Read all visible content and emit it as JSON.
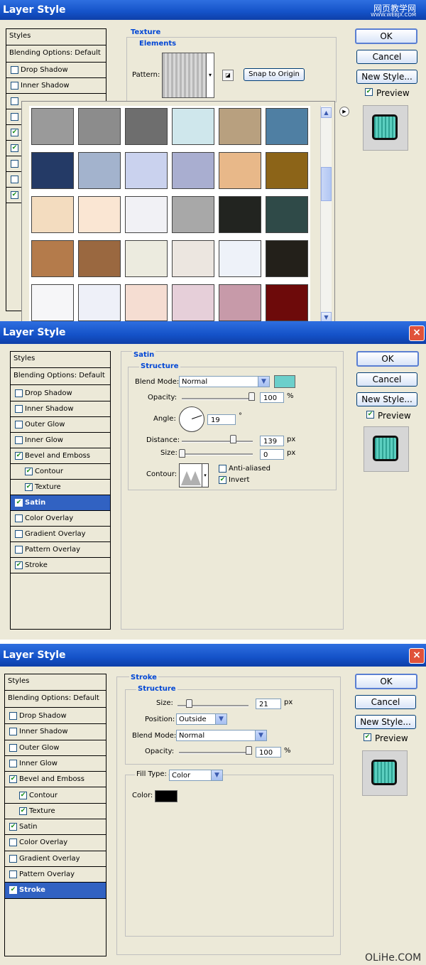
{
  "watermark_top": "网页教学网",
  "watermark_top_url": "WWW.WEBJX.COM",
  "watermark_bottom": "OLiHe.COM",
  "colors": {
    "accent": "#0046d5",
    "selected_row": "#3162c2",
    "satin_color": "#6ccfcb",
    "stroke_color": "#000000",
    "preview": "#3fb3a4"
  },
  "dialog1": {
    "title": "Layer Style",
    "styles_header": "Styles",
    "blending": "Blending Options: Default",
    "items": [
      {
        "label": "Drop Shadow",
        "checked": false
      },
      {
        "label": "Inner Shadow",
        "checked": false
      },
      {
        "label": "",
        "checked": false
      },
      {
        "label": "",
        "checked": false
      },
      {
        "label": "",
        "checked": true
      },
      {
        "label": "",
        "checked": true
      },
      {
        "label": "",
        "checked": false
      },
      {
        "label": "",
        "checked": false
      },
      {
        "label": "",
        "checked": true
      }
    ],
    "section": "Texture",
    "subsection": "Elements",
    "pattern_label": "Pattern:",
    "snap_button": "Snap to Origin",
    "buttons": {
      "ok": "OK",
      "cancel": "Cancel",
      "new_style": "New Style...",
      "preview": "Preview"
    },
    "swatches": [
      "#9a9a9a",
      "#8c8c8c",
      "#6e6e6e",
      "#cfe7ec",
      "#b8a07f",
      "#4f7fa3",
      "#243a66",
      "#a3b3cd",
      "#cad2ee",
      "#a9aed0",
      "#e8b889",
      "#8c6418",
      "#f3dcbf",
      "#fae6d3",
      "#f1f1f5",
      "#a8a8a8",
      "#222420",
      "#2f4a48",
      "#b47b4b",
      "#9a6840",
      "#ecebdf",
      "#ece6e0",
      "#eef2f9",
      "#23201a",
      "#f6f6f8",
      "#eef0f8",
      "#f5ddd2",
      "#e6cfd9",
      "#c79aa9",
      "#6d0a0a"
    ]
  },
  "dialog2": {
    "title": "Layer Style",
    "close": "×",
    "styles_header": "Styles",
    "blending": "Blending Options: Default",
    "items": [
      {
        "label": "Drop Shadow",
        "checked": false,
        "indent": false
      },
      {
        "label": "Inner Shadow",
        "checked": false,
        "indent": false
      },
      {
        "label": "Outer Glow",
        "checked": false,
        "indent": false
      },
      {
        "label": "Inner Glow",
        "checked": false,
        "indent": false
      },
      {
        "label": "Bevel and Emboss",
        "checked": true,
        "indent": false
      },
      {
        "label": "Contour",
        "checked": true,
        "indent": true
      },
      {
        "label": "Texture",
        "checked": true,
        "indent": true
      },
      {
        "label": "Satin",
        "checked": true,
        "indent": false,
        "selected": true
      },
      {
        "label": "Color Overlay",
        "checked": false,
        "indent": false
      },
      {
        "label": "Gradient Overlay",
        "checked": false,
        "indent": false
      },
      {
        "label": "Pattern Overlay",
        "checked": false,
        "indent": false
      },
      {
        "label": "Stroke",
        "checked": true,
        "indent": false
      }
    ],
    "section": "Satin",
    "subsection": "Structure",
    "blend_mode_label": "Blend Mode:",
    "blend_mode": "Normal",
    "opacity_label": "Opacity:",
    "opacity": "100",
    "opacity_unit": "%",
    "angle_label": "Angle:",
    "angle": "19",
    "angle_unit": "°",
    "distance_label": "Distance:",
    "distance": "139",
    "distance_unit": "px",
    "size_label": "Size:",
    "size": "0",
    "size_unit": "px",
    "contour_label": "Contour:",
    "anti_aliased": "Anti-aliased",
    "invert": "Invert",
    "buttons": {
      "ok": "OK",
      "cancel": "Cancel",
      "new_style": "New Style...",
      "preview": "Preview"
    }
  },
  "dialog3": {
    "title": "Layer Style",
    "close": "×",
    "styles_header": "Styles",
    "blending": "Blending Options: Default",
    "items": [
      {
        "label": "Drop Shadow",
        "checked": false,
        "indent": false
      },
      {
        "label": "Inner Shadow",
        "checked": false,
        "indent": false
      },
      {
        "label": "Outer Glow",
        "checked": false,
        "indent": false
      },
      {
        "label": "Inner Glow",
        "checked": false,
        "indent": false
      },
      {
        "label": "Bevel and Emboss",
        "checked": true,
        "indent": false
      },
      {
        "label": "Contour",
        "checked": true,
        "indent": true
      },
      {
        "label": "Texture",
        "checked": true,
        "indent": true
      },
      {
        "label": "Satin",
        "checked": true,
        "indent": false
      },
      {
        "label": "Color Overlay",
        "checked": false,
        "indent": false
      },
      {
        "label": "Gradient Overlay",
        "checked": false,
        "indent": false
      },
      {
        "label": "Pattern Overlay",
        "checked": false,
        "indent": false
      },
      {
        "label": "Stroke",
        "checked": true,
        "indent": false,
        "selected": true
      }
    ],
    "section": "Stroke",
    "subsection": "Structure",
    "size_label": "Size:",
    "size": "21",
    "size_unit": "px",
    "position_label": "Position:",
    "position": "Outside",
    "blend_mode_label": "Blend Mode:",
    "blend_mode": "Normal",
    "opacity_label": "Opacity:",
    "opacity": "100",
    "opacity_unit": "%",
    "fill_type_label": "Fill Type:",
    "fill_type": "Color",
    "color_label": "Color:",
    "buttons": {
      "ok": "OK",
      "cancel": "Cancel",
      "new_style": "New Style...",
      "preview": "Preview"
    }
  }
}
